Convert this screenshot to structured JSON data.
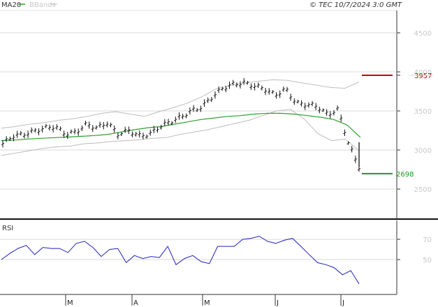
{
  "header": {
    "legend_ma": "MA20",
    "legend_bb": "BBands",
    "copyright": "© TEC 10/7/2024 3:0 GMT"
  },
  "rsi_label": "RSI",
  "colors": {
    "ma": "#2e9e2e",
    "bb": "#bdbdbd",
    "price": "#111111",
    "resistance": "#c00000",
    "support": "#1a9a1a",
    "rsi": "#2020c0",
    "grid": "#d8d8d8"
  },
  "chart_data": [
    {
      "type": "ohlc",
      "title": "",
      "x_axis": {
        "type": "time",
        "tick_labels": [
          "M",
          "A",
          "M",
          "J",
          "J"
        ]
      },
      "y_axis": {
        "ticks": [
          2500,
          3000,
          3500,
          4000,
          4500
        ],
        "range": [
          2200,
          4800
        ],
        "grid": true
      },
      "series": [
        {
          "name": "MA20",
          "kind": "line",
          "values": [
            3120,
            3128,
            3140,
            3150,
            3158,
            3166,
            3175,
            3185,
            3200,
            3230,
            3260,
            3285,
            3300,
            3330,
            3360,
            3390,
            3410,
            3430,
            3440,
            3460,
            3470,
            3470,
            3460,
            3440,
            3420,
            3390,
            3320,
            3160
          ]
        },
        {
          "name": "BBands upper",
          "kind": "line",
          "values": [
            3280,
            3300,
            3330,
            3350,
            3380,
            3400,
            3430,
            3470,
            3490,
            3460,
            3430,
            3490,
            3540,
            3600,
            3680,
            3780,
            3830,
            3860,
            3880,
            3900,
            3890,
            3860,
            3830,
            3800,
            3790,
            3870
          ]
        },
        {
          "name": "BBands lower",
          "kind": "line",
          "values": [
            2930,
            2960,
            2990,
            3020,
            3040,
            3050,
            3080,
            3090,
            3110,
            3120,
            3130,
            3150,
            3160,
            3200,
            3230,
            3260,
            3300,
            3340,
            3380,
            3440,
            3500,
            3520,
            3400,
            3210,
            3120,
            3140,
            2990
          ]
        }
      ],
      "levels": [
        {
          "label": "3957",
          "value": 3957,
          "role": "resistance"
        },
        {
          "label": "2698",
          "value": 2698,
          "role": "support"
        }
      ],
      "price_path_close": [
        3080,
        3180,
        3200,
        3240,
        3280,
        3300,
        3200,
        3230,
        3330,
        3280,
        3350,
        3200,
        3250,
        3180,
        3200,
        3300,
        3360,
        3420,
        3500,
        3550,
        3680,
        3790,
        3840,
        3860,
        3820,
        3780,
        3700,
        3780,
        3600,
        3580,
        3560,
        3450,
        3520,
        3080,
        2780
      ]
    },
    {
      "type": "line",
      "title": "RSI",
      "y_axis": {
        "ticks": [
          50,
          70
        ],
        "range": [
          25,
          95
        ]
      },
      "series": [
        {
          "name": "RSI",
          "values": [
            50,
            56,
            61,
            64,
            55,
            62,
            61,
            61,
            57,
            66,
            68,
            62,
            53,
            60,
            61,
            47,
            54,
            51,
            53,
            52,
            63,
            45,
            51,
            54,
            48,
            46,
            63,
            63,
            63,
            70,
            71,
            73,
            68,
            66,
            69,
            71,
            63,
            55,
            47,
            45,
            42,
            35,
            39,
            26
          ]
        }
      ]
    }
  ]
}
